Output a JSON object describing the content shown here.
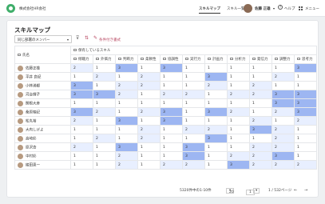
{
  "header": {
    "company": "株式会社HR会社",
    "nav": [
      "スキルマップ",
      "スキル一覧"
    ],
    "user": "佐藤 正雄",
    "help": "ヘルプ",
    "menu": "メニュー"
  },
  "page": {
    "title": "スキルマップ",
    "filter": "同じ部署のメンバー",
    "conditional_format": "条件付き書式"
  },
  "table": {
    "name_header": "氏名",
    "group_header": "保有しているスキル",
    "skills": [
      "傾聴力",
      "外価力",
      "判断力",
      "柔軟性",
      "協調性",
      "実行力",
      "計画力",
      "分析力",
      "発信力",
      "調整力",
      "思考力"
    ],
    "rows": [
      {
        "name": "佐藤正雄",
        "values": [
          2,
          1,
          3,
          1,
          3,
          1,
          1,
          1,
          1,
          1,
          3
        ]
      },
      {
        "name": "平井 良紀",
        "values": [
          1,
          2,
          1,
          2,
          1,
          1,
          3,
          1,
          1,
          2,
          1
        ]
      },
      {
        "name": "小林満都",
        "values": [
          3,
          1,
          2,
          2,
          1,
          1,
          2,
          1,
          2,
          1,
          1
        ]
      },
      {
        "name": "河合輝子",
        "values": [
          3,
          3,
          2,
          1,
          2,
          2,
          1,
          2,
          2,
          3,
          3
        ]
      },
      {
        "name": "関根大彦",
        "values": [
          1,
          1,
          1,
          1,
          1,
          1,
          1,
          1,
          1,
          3,
          3
        ]
      },
      {
        "name": "桑原柚記",
        "values": [
          3,
          2,
          1,
          2,
          3,
          1,
          3,
          2,
          1,
          2,
          3
        ]
      },
      {
        "name": "松丸裕",
        "values": [
          2,
          1,
          3,
          1,
          3,
          1,
          1,
          1,
          2,
          1,
          2
        ]
      },
      {
        "name": "大内しげよ",
        "values": [
          1,
          1,
          1,
          2,
          1,
          2,
          2,
          1,
          3,
          2,
          1
        ]
      },
      {
        "name": "高崎彩",
        "values": [
          1,
          2,
          1,
          2,
          1,
          1,
          3,
          1,
          1,
          2,
          1
        ]
      },
      {
        "name": "原沢杏",
        "values": [
          2,
          1,
          3,
          1,
          1,
          3,
          1,
          1,
          2,
          2,
          1
        ]
      },
      {
        "name": "中村彩",
        "values": [
          1,
          1,
          2,
          1,
          1,
          3,
          1,
          2,
          2,
          3,
          1
        ]
      },
      {
        "name": "綾田恵一",
        "values": [
          1,
          1,
          2,
          1,
          2,
          2,
          1,
          3,
          2,
          2,
          2
        ]
      }
    ]
  },
  "pager": {
    "range": "5320件中の1-10件",
    "per_page": "20",
    "page_info": "1 / 532ページ"
  }
}
